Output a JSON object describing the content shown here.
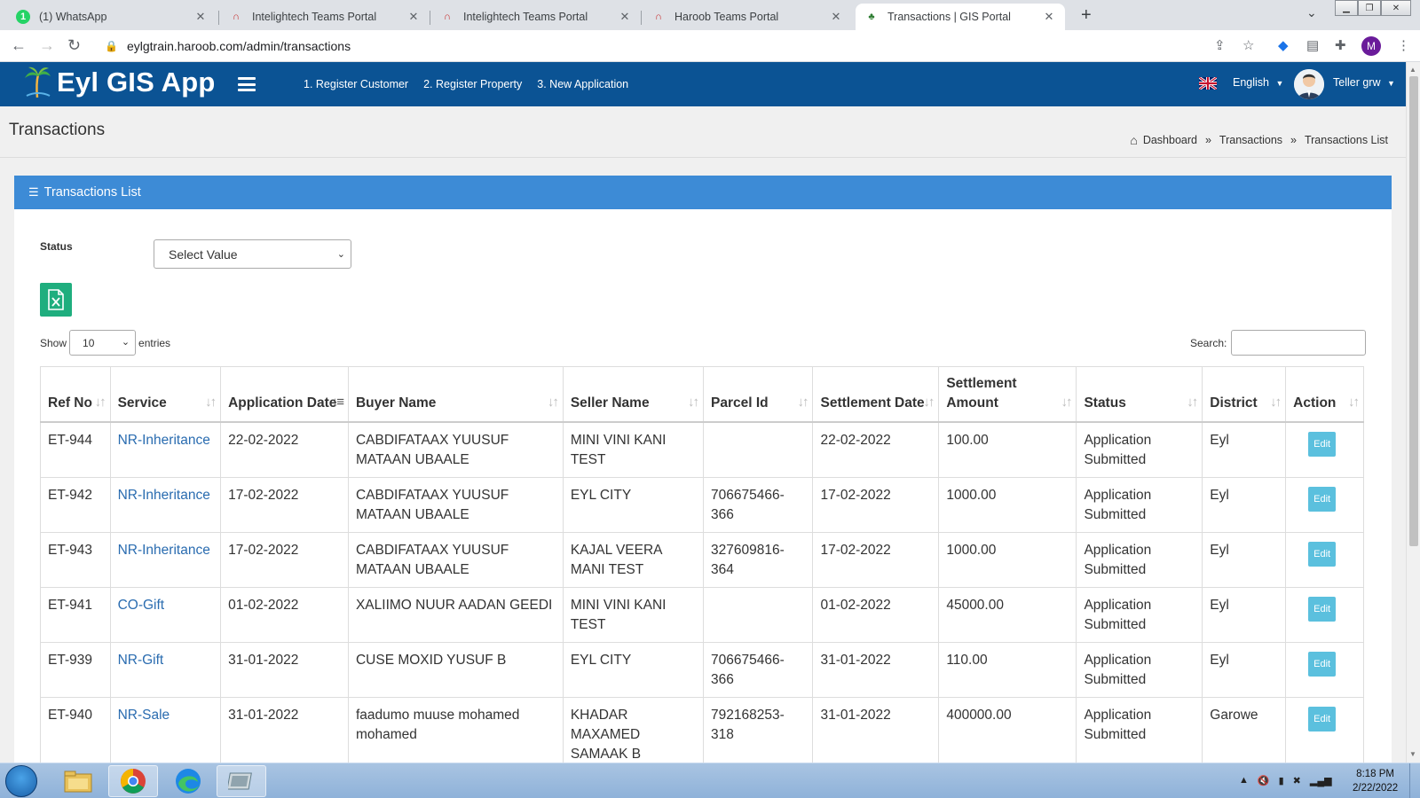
{
  "browser": {
    "tabs": [
      {
        "title": "(1) WhatsApp",
        "badge": "1"
      },
      {
        "title": "Intelightech Teams Portal"
      },
      {
        "title": "Intelightech Teams Portal"
      },
      {
        "title": "Haroob Teams Portal"
      },
      {
        "title": "Transactions | GIS Portal"
      }
    ],
    "url": "eylgtrain.haroob.com/admin/transactions",
    "profile_initial": "M"
  },
  "app": {
    "brand": "Eyl GIS App",
    "menu": [
      "1. Register Customer",
      "2. Register Property",
      "3. New Application"
    ],
    "language": "English",
    "user": "Teller grw"
  },
  "page": {
    "title": "Transactions",
    "breadcrumb": [
      "Dashboard",
      "Transactions",
      "Transactions List"
    ],
    "separator": "»"
  },
  "panel": {
    "title": "Transactions List",
    "status_label": "Status",
    "status_value": "Select Value",
    "show_label": "Show",
    "entries_value": "10",
    "entries_label": "entries",
    "search_label": "Search:"
  },
  "table": {
    "headers": [
      "Ref No",
      "Service",
      "Application Date",
      "Buyer Name",
      "Seller Name",
      "Parcel Id",
      "Settlement Date",
      "Settlement Amount",
      "Status",
      "District",
      "Action"
    ],
    "rows": [
      {
        "ref": "ET-944",
        "service": "NR-Inheritance",
        "app_date": "22-02-2022",
        "buyer": "CABDIFATAAX YUUSUF MATAAN UBAALE",
        "seller": "MINI VINI KANI TEST",
        "parcel": "",
        "settle_date": "22-02-2022",
        "amount": "100.00",
        "status": "Application Submitted",
        "district": "Eyl",
        "action": "Edit"
      },
      {
        "ref": "ET-942",
        "service": "NR-Inheritance",
        "app_date": "17-02-2022",
        "buyer": "CABDIFATAAX YUUSUF MATAAN UBAALE",
        "seller": "EYL CITY",
        "parcel": "706675466-366",
        "settle_date": "17-02-2022",
        "amount": "1000.00",
        "status": "Application Submitted",
        "district": "Eyl",
        "action": "Edit"
      },
      {
        "ref": "ET-943",
        "service": "NR-Inheritance",
        "app_date": "17-02-2022",
        "buyer": "CABDIFATAAX YUUSUF MATAAN UBAALE",
        "seller": "KAJAL VEERA MANI TEST",
        "parcel": "327609816-364",
        "settle_date": "17-02-2022",
        "amount": "1000.00",
        "status": "Application Submitted",
        "district": "Eyl",
        "action": "Edit"
      },
      {
        "ref": "ET-941",
        "service": "CO-Gift",
        "app_date": "01-02-2022",
        "buyer": "XALIIMO NUUR AADAN GEEDI",
        "seller": "MINI VINI KANI TEST",
        "parcel": "",
        "settle_date": "01-02-2022",
        "amount": "45000.00",
        "status": "Application Submitted",
        "district": "Eyl",
        "action": "Edit"
      },
      {
        "ref": "ET-939",
        "service": "NR-Gift",
        "app_date": "31-01-2022",
        "buyer": "CUSE MOXID YUSUF B",
        "seller": "EYL CITY",
        "parcel": "706675466-366",
        "settle_date": "31-01-2022",
        "amount": "110.00",
        "status": "Application Submitted",
        "district": "Eyl",
        "action": "Edit"
      },
      {
        "ref": "ET-940",
        "service": "NR-Sale",
        "app_date": "31-01-2022",
        "buyer": "faadumo muuse mohamed mohamed",
        "seller": "KHADAR MAXAMED SAMAAK B",
        "parcel": "792168253-318",
        "settle_date": "31-01-2022",
        "amount": "400000.00",
        "status": "Application Submitted",
        "district": "Garowe",
        "action": "Edit"
      }
    ]
  },
  "taskbar": {
    "time": "8:18 PM",
    "date": "2/22/2022"
  }
}
